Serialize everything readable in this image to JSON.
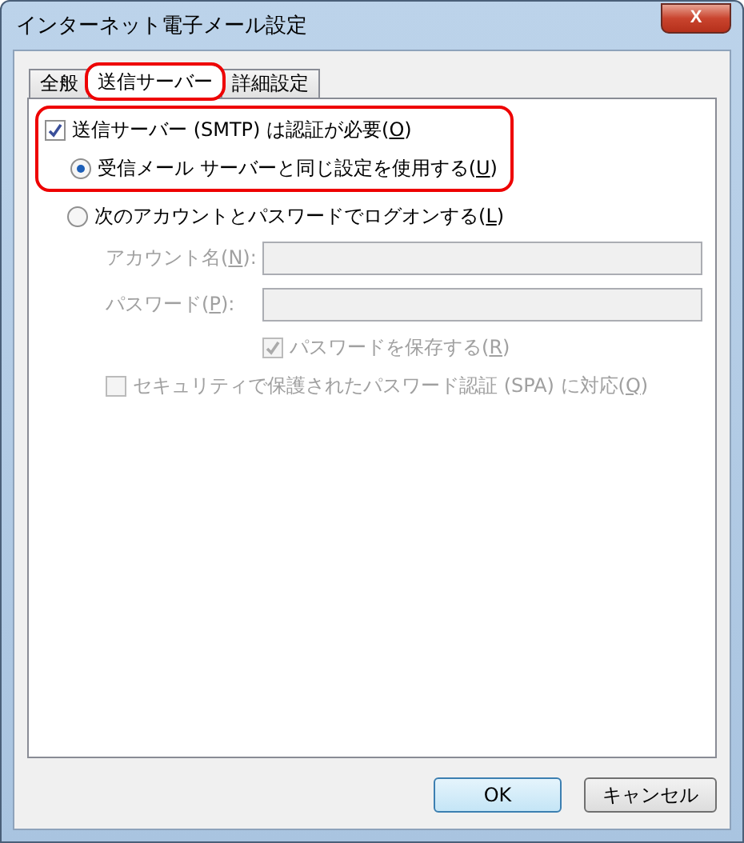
{
  "window": {
    "title": "インターネット電子メール設定",
    "close_label": "X"
  },
  "tabs": [
    {
      "label": "全般",
      "selected": false,
      "highlighted": false
    },
    {
      "label": "送信サーバー",
      "selected": true,
      "highlighted": true
    },
    {
      "label": "詳細設定",
      "selected": false,
      "highlighted": false
    }
  ],
  "auth": {
    "checked": true,
    "highlighted": true,
    "label": {
      "text": "送信サーバー (SMTP) は認証が必要(",
      "key": "O",
      "end": ")"
    }
  },
  "options": [
    {
      "selected": true,
      "label": {
        "text": "受信メール サーバーと同じ設定を使用する(",
        "key": "U",
        "end": ")"
      }
    },
    {
      "selected": false,
      "label": {
        "text": "次のアカウントとパスワードでログオンする(",
        "key": "L",
        "end": ")"
      }
    }
  ],
  "fields": [
    {
      "disabled": true,
      "label": {
        "text": "アカウント名(",
        "key": "N",
        "end": "):"
      }
    },
    {
      "disabled": true,
      "label": {
        "text": "パスワード(",
        "key": "P",
        "end": "):"
      }
    }
  ],
  "checkboxes": [
    {
      "checked": true,
      "disabled": true,
      "indent": true,
      "label": {
        "text": "パスワードを保存する(",
        "key": "R",
        "end": ")"
      }
    },
    {
      "checked": false,
      "disabled": true,
      "indent": false,
      "label": {
        "text": "セキュリティで保護されたパスワード認証 (SPA) に対応(",
        "key": "Q",
        "end": ")"
      }
    }
  ],
  "buttons": [
    {
      "label": "OK",
      "default": true
    },
    {
      "label": "キャンセル",
      "default": false
    }
  ]
}
